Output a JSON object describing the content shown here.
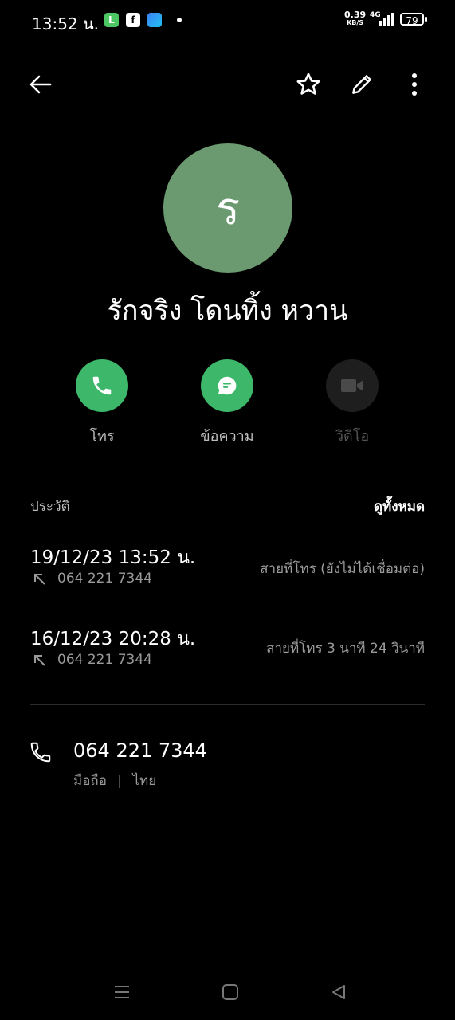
{
  "status_bar": {
    "time": "13:52 น.",
    "speed_value": "0.39",
    "speed_unit": "KB/S",
    "network": "4G",
    "battery": "79"
  },
  "toolbar": {
    "back_icon": "arrow-left-icon",
    "favorite_icon": "star-outline-icon",
    "edit_icon": "pencil-icon",
    "more_icon": "more-vertical-icon"
  },
  "contact": {
    "initial": "ร",
    "avatar_color": "#6b9a71",
    "name": "รักจริง โดนทิ้ง หวาน"
  },
  "actions": [
    {
      "label": "โทร",
      "icon": "phone-icon",
      "color": "#3db86a",
      "enabled": true
    },
    {
      "label": "ข้อความ",
      "icon": "message-icon",
      "color": "#3db86a",
      "enabled": true
    },
    {
      "label": "วิดีโอ",
      "icon": "video-icon",
      "color": "#1e1e1e",
      "enabled": false
    }
  ],
  "history": {
    "title": "ประวัติ",
    "view_all": "ดูทั้งหมด",
    "items": [
      {
        "datetime": "19/12/23 13:52 น.",
        "number": "064 221 7344",
        "status": "สายที่โทร (ยังไม่ได้เชื่อมต่อ)"
      },
      {
        "datetime": "16/12/23 20:28 น.",
        "number": "064 221 7344",
        "status": "สายที่โทร  3 นาที 24 วินาที"
      }
    ]
  },
  "phone": {
    "number": "064 221 7344",
    "type": "มือถือ",
    "separator": "|",
    "country": "ไทย"
  }
}
